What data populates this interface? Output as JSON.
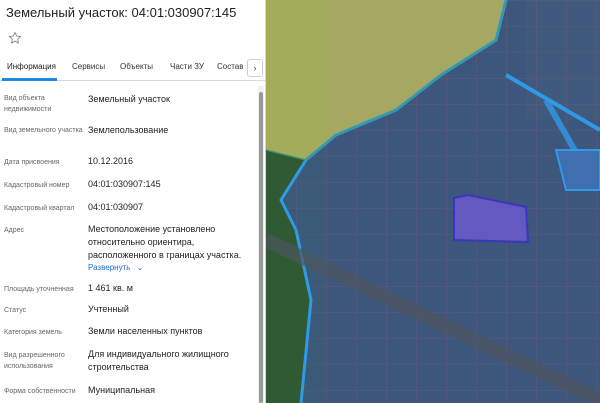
{
  "header": {
    "title": "Земельный участок: 04:01:030907:145"
  },
  "tabs": [
    {
      "label": "Информация"
    },
    {
      "label": "Сервисы"
    },
    {
      "label": "Объекты"
    },
    {
      "label": "Части ЗУ"
    },
    {
      "label": "Состав"
    }
  ],
  "tabs_scroll_arrow": "›",
  "info": {
    "object_type_label": "Вид объекта недвижимости",
    "object_type_value": "Земельный участок",
    "land_type_label": "Вид земельного участка",
    "land_type_value": "Землепользование",
    "date_label": "Дата присвоения",
    "date_value": "10.12.2016",
    "cadastral_number_label": "Кадастровый номер",
    "cadastral_number_value": "04:01:030907:145",
    "cadastral_quarter_label": "Кадастровый квартал",
    "cadastral_quarter_value": "04:01:030907",
    "address_label": "Адрес",
    "address_value": "Местоположение установлено относительно ориентира, расположенного в границах участка.",
    "expand_link": "Развернуть",
    "area_label": "Площадь уточненная",
    "area_value": "1 461 кв. м",
    "status_label": "Статус",
    "status_value": "Учтенный",
    "category_label": "Категория земель",
    "category_value": "Земли населенных пунктов",
    "permitted_use_label": "Вид разрешенного использования",
    "permitted_use_value": "Для индивидуального жилищного строительства",
    "ownership_label": "Форма собственности",
    "ownership_value": "Муниципальная"
  },
  "colors": {
    "accent": "#1e88e5",
    "link": "#1e6fd0",
    "zone_yellow": "#c9c86a",
    "zone_blue": "#3d5a8a",
    "parcel_highlight": "#6a5acd",
    "cadastral_lines": "#b06a8a"
  }
}
